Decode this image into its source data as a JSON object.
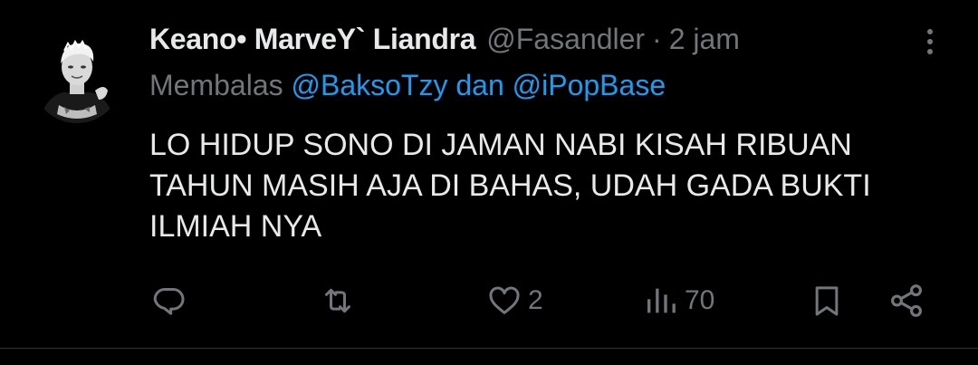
{
  "tweet": {
    "display_name": "Keano• MarveY` Liandra",
    "handle": "@Fasandler",
    "separator": "·",
    "time": "2 jam",
    "reply_prefix": "Membalas",
    "reply_mention_1": "@BaksoTzy",
    "reply_joiner": "dan",
    "reply_mention_2": "@iPopBase",
    "text_lines": [
      "LO HIDUP SONO DI JAMAN NABI KISAH RIBUAN",
      "TAHUN MASIH AJA DI BAHAS, UDAH GADA BUKTI",
      "ILMIAH NYA"
    ]
  },
  "actions": {
    "reply": {
      "icon": "reply-icon",
      "count": ""
    },
    "retweet": {
      "icon": "retweet-icon",
      "count": ""
    },
    "like": {
      "icon": "heart-icon",
      "count": "2"
    },
    "views": {
      "icon": "views-icon",
      "count": "70"
    },
    "bookmark": {
      "icon": "bookmark-icon",
      "count": ""
    },
    "share": {
      "icon": "share-icon",
      "count": ""
    }
  },
  "colors": {
    "background": "#000000",
    "text_primary": "#e7e9ea",
    "text_secondary": "#71767b",
    "accent": "#1d9bf0",
    "divider": "#2f3336"
  }
}
